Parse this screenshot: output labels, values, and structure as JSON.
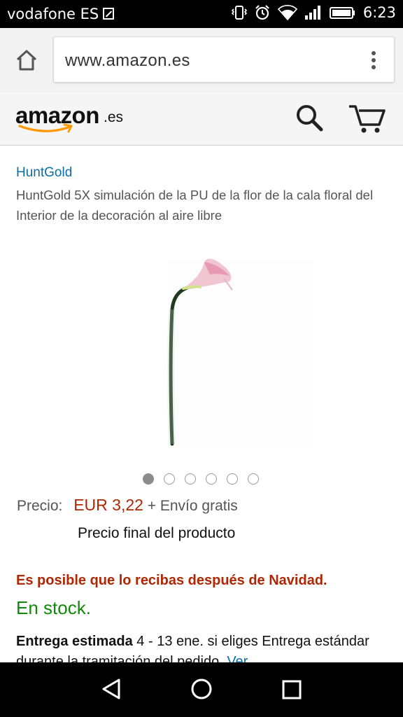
{
  "status_bar": {
    "carrier": "vodafone ES",
    "time": "6:23",
    "icons": [
      "sim-status-icon",
      "vibrate-icon",
      "alarm-icon",
      "wifi-icon",
      "signal-icon",
      "battery-icon"
    ]
  },
  "browser": {
    "url": "www.amazon.es",
    "icons": [
      "home-icon",
      "overflow-menu-icon"
    ]
  },
  "amazon_header": {
    "logo_text": "amazon",
    "logo_tld": ".es",
    "icons": [
      "search-icon",
      "cart-icon"
    ]
  },
  "product": {
    "brand": "HuntGold",
    "title": "HuntGold 5X simulación de la PU de la flor de la cala floral del Interior de la decoración al aire libre",
    "image_icon": "calla-lily-flower-image",
    "carousel": {
      "count": 6,
      "active_index": 1
    },
    "price_label": "Precio:",
    "price": "EUR 3,22",
    "shipping": "+ Envío gratis",
    "final_price_note": "Precio final del producto",
    "christmas_notice": "Es posible que lo recibas después de Navidad.",
    "stock": "En stock.",
    "delivery_label": "Entrega estimada",
    "delivery_text": "4 - 13 ene. si eliges Entrega estándar durante la tramitación del pedido.",
    "delivery_link": "Ver"
  },
  "colors": {
    "price": "#b12704",
    "stock": "#128a09",
    "link": "#0a6fa6",
    "smile": "#f90"
  },
  "nav_bar": {
    "icons": [
      "back-icon",
      "home-circle-icon",
      "recents-icon"
    ]
  }
}
